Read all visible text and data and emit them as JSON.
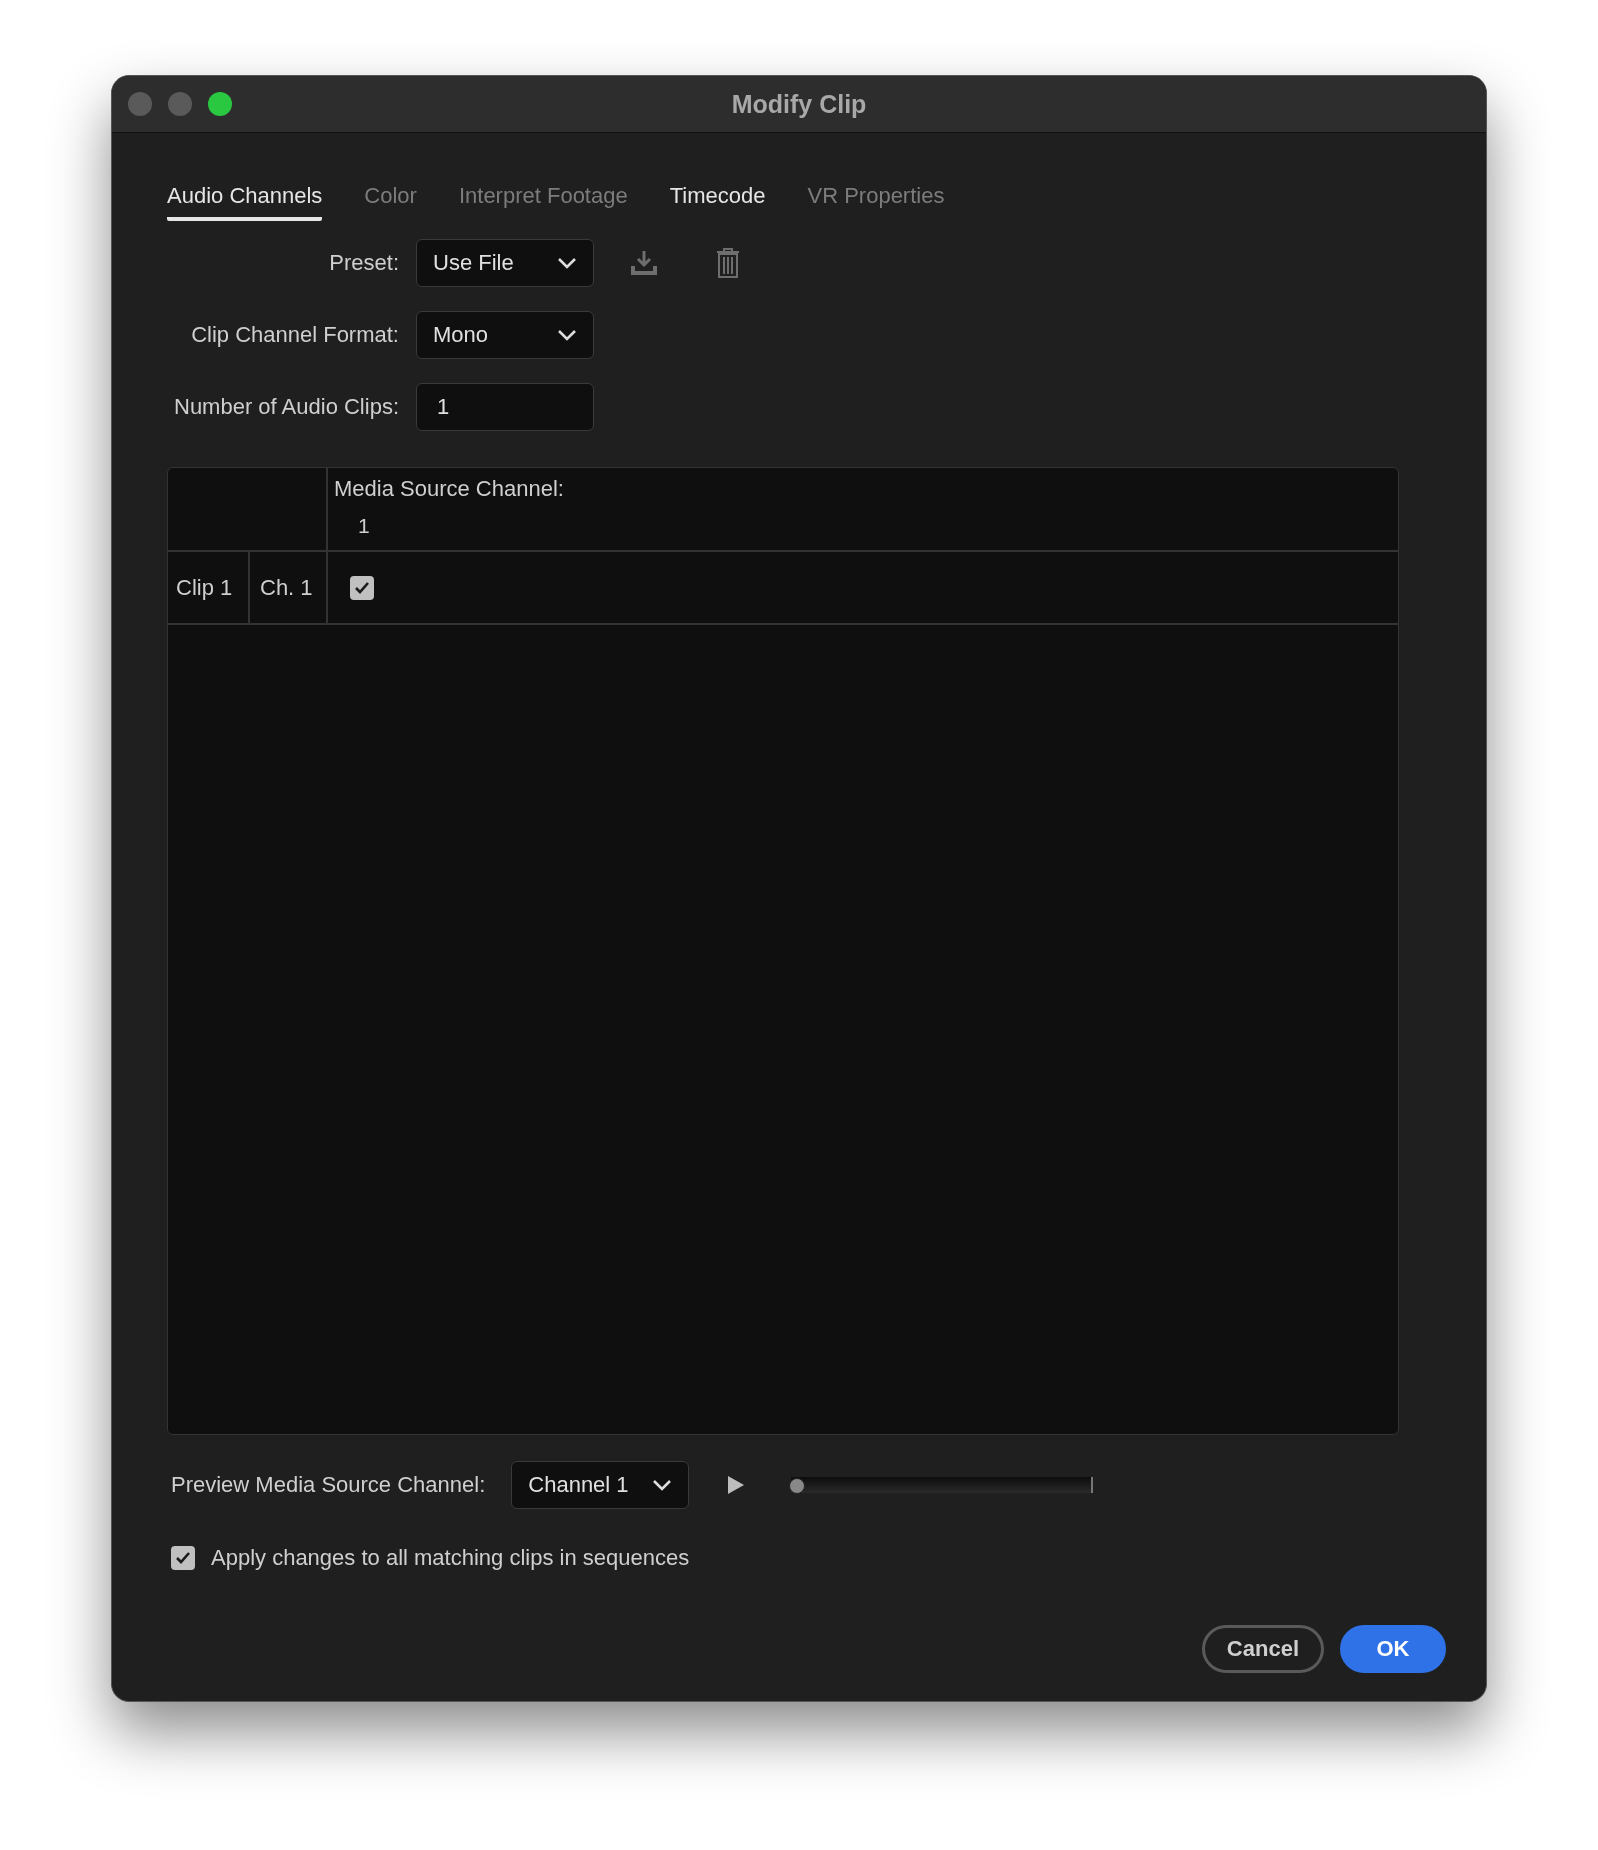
{
  "window": {
    "title": "Modify Clip"
  },
  "tabs": [
    {
      "label": "Audio Channels",
      "selected": true,
      "disabled": false
    },
    {
      "label": "Color",
      "selected": false,
      "disabled": true
    },
    {
      "label": "Interpret Footage",
      "selected": false,
      "disabled": true
    },
    {
      "label": "Timecode",
      "selected": false,
      "disabled": false
    },
    {
      "label": "VR Properties",
      "selected": false,
      "disabled": true
    }
  ],
  "fields": [
    {
      "label": "Preset:",
      "value": "Use File",
      "kind": "dropdown",
      "actions": true
    },
    {
      "label": "Clip Channel Format:",
      "value": "Mono",
      "kind": "dropdown",
      "actions": false
    },
    {
      "label": "Number of Audio Clips:",
      "value": "1",
      "kind": "input",
      "actions": false
    }
  ],
  "table": {
    "header": "Media Source Channel:",
    "channels": [
      "1"
    ],
    "rows": [
      {
        "clip": "Clip 1",
        "channel": "Ch. 1",
        "cells": [
          {
            "checked": true
          }
        ]
      }
    ]
  },
  "preview": {
    "label": "Preview Media Source Channel:",
    "value": "Channel 1",
    "level": 0
  },
  "apply": {
    "label": "Apply changes to all matching clips in sequences",
    "checked": true
  },
  "buttons": [
    {
      "label": "Cancel",
      "kind": "secondary"
    },
    {
      "label": "OK",
      "kind": "primary"
    }
  ]
}
